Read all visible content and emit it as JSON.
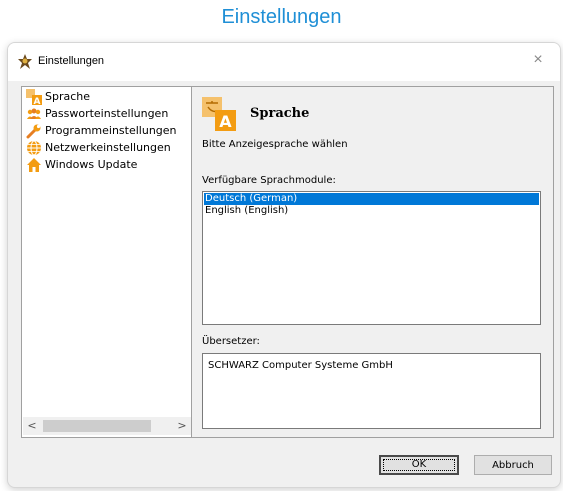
{
  "caption": "Einstellungen",
  "window": {
    "title": "Einstellungen",
    "close_glyph": "×"
  },
  "tree": {
    "items": [
      {
        "label": "Sprache",
        "icon": "language-icon"
      },
      {
        "label": "Passworteinstellungen",
        "icon": "users-icon"
      },
      {
        "label": "Programmeinstellungen",
        "icon": "wrench-icon"
      },
      {
        "label": "Netzwerkeinstellungen",
        "icon": "globe-icon"
      },
      {
        "label": "Windows Update",
        "icon": "house-icon"
      }
    ],
    "scroll_left": "<",
    "scroll_right": ">"
  },
  "panel": {
    "icon": "language-icon",
    "title": "Sprache",
    "subtitle": "Bitte Anzeigesprache wählen",
    "modules_label": "Verfügbare Sprachmodule:",
    "modules": [
      {
        "label": "Deutsch (German)",
        "selected": true
      },
      {
        "label": "English (English)",
        "selected": false
      }
    ],
    "translator_label": "Übersetzer:",
    "translator_value": "SCHWARZ Computer Systeme GmbH"
  },
  "buttons": {
    "ok": "OK",
    "cancel": "Abbruch"
  },
  "colors": {
    "caption": "#1f8fd6",
    "selection": "#0078d7",
    "icon_orange": "#f39c12"
  }
}
